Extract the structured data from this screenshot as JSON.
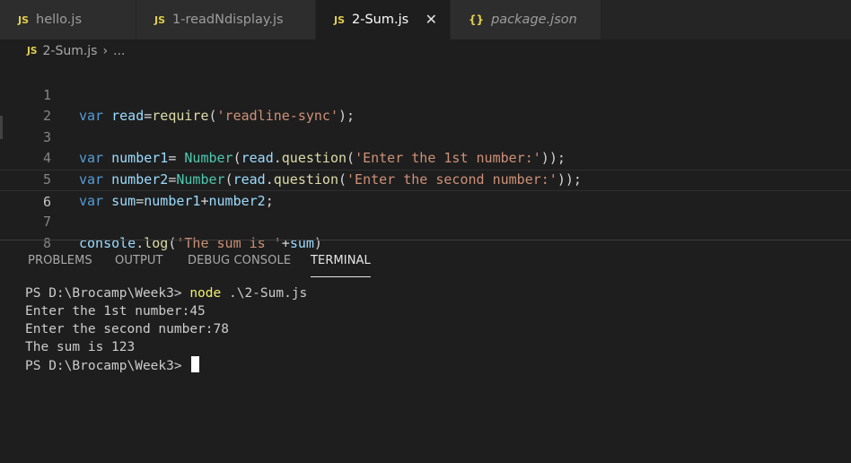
{
  "tabs": [
    {
      "icon": "JS",
      "label": "hello.js"
    },
    {
      "icon": "JS",
      "label": "1-readNdisplay.js"
    },
    {
      "icon": "JS",
      "label": "2-Sum.js"
    },
    {
      "icon": "{}",
      "label": "package.json"
    }
  ],
  "tab_close_glyph": "✕",
  "breadcrumb": {
    "icon": "JS",
    "file": "2-Sum.js",
    "separator": "›",
    "more": "..."
  },
  "editor": {
    "line_numbers": [
      "1",
      "2",
      "3",
      "4",
      "5",
      "6",
      "7",
      "8"
    ],
    "lines": [
      "var read=require('readline-sync');",
      "",
      "var number1= Number(read.question('Enter the 1st number:'));",
      "var number2=Number(read.question('Enter the second number:'));",
      "var sum=number1+number2;",
      "",
      "console.log('The sum is '+sum)",
      ""
    ]
  },
  "panel": {
    "tabs": [
      "PROBLEMS",
      "OUTPUT",
      "DEBUG CONSOLE",
      "TERMINAL"
    ],
    "active_tab": "TERMINAL"
  },
  "terminal": {
    "prompt1": "PS D:\\Brocamp\\Week3> ",
    "command": "node",
    "command_args": " .\\2-Sum.js",
    "output": [
      "Enter the 1st number:45",
      "Enter the second number:78",
      "The sum is 123"
    ],
    "prompt2": "PS D:\\Brocamp\\Week3> "
  },
  "colors": {
    "keyword": "#569cd6",
    "variable": "#9cdcfe",
    "function": "#dcdcaa",
    "class": "#4ec9b0",
    "string": "#ce9178",
    "js_icon": "#e2d04a",
    "terminal_command": "#f2f06a"
  }
}
